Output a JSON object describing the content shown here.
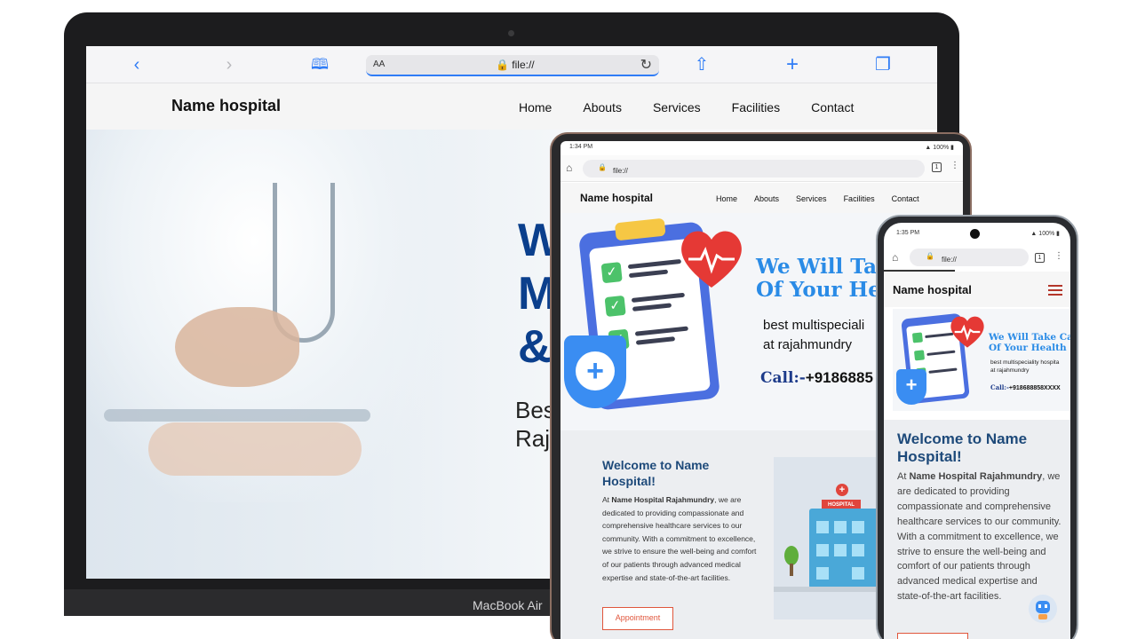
{
  "mac": {
    "device_label": "MacBook Air",
    "safari": {
      "aa_label": "AA",
      "address": "file://"
    },
    "site": {
      "brand": "Name hospital",
      "nav": [
        "Home",
        "Abouts",
        "Services",
        "Facilities",
        "Contact"
      ],
      "hero_title_visible": "W\nM\n&",
      "hero_sub_visible": "Bes\nRaj"
    }
  },
  "tablet": {
    "status_time": "1:34 PM",
    "status_right": "100%",
    "address": "file://",
    "tab_count": "1",
    "site": {
      "brand": "Name hospital",
      "nav": [
        "Home",
        "Abouts",
        "Services",
        "Facilities",
        "Contact"
      ],
      "hero_title": "We Will Ta\nOf Your He",
      "hero_sub": "best multispeciali\nat rajahmundry",
      "call_label": "Call:-",
      "call_number": "+9186885"
    },
    "welcome": {
      "heading": "Welcome to Name Hospital!",
      "intro_prefix": "At ",
      "intro_bold": "Name Hospital Rajahmundry",
      "intro_rest": ", we are dedicated to providing compassionate and comprehensive healthcare services to our community. With a commitment to excellence, we strive to ensure the well-being and comfort of our patients through advanced medical expertise and state-of-the-art facilities.",
      "button": "Appointment",
      "image_sign": "HOSPITAL"
    }
  },
  "phone": {
    "status_time": "1:35 PM",
    "status_right": "100%",
    "address": "file://",
    "tab_count": "1",
    "site": {
      "brand": "Name hospital",
      "hero_title": "We Will Take Ca\nOf Your Health",
      "hero_sub": "best multispeciality hospita\nat rajahmundry",
      "call_label": "Call:-",
      "call_number": "+918688858XXXX"
    },
    "welcome": {
      "heading": "Welcome to Name Hospital!",
      "intro_prefix": "At ",
      "intro_bold": "Name Hospital Rajahmundry",
      "intro_rest": ", we are dedicated to providing compassionate and comprehensive healthcare services to our community. With a commitment to excellence, we strive to ensure the well-being and comfort of our patients through advanced medical expertise and state-of-the-art facilities."
    }
  },
  "colors": {
    "brand_blue": "#2a8be6",
    "heading_navy": "#1e4a7a",
    "accent_red": "#e0563c",
    "hamburger": "#b3362a"
  }
}
